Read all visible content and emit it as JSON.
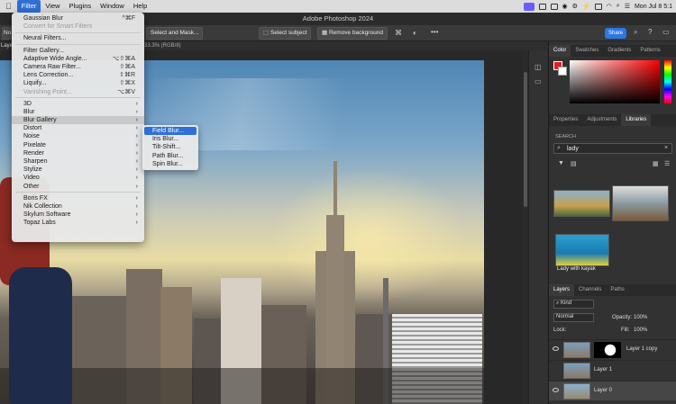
{
  "menubar": {
    "apple": "",
    "items": [
      "Filter",
      "View",
      "Plugins",
      "Window",
      "Help"
    ],
    "clock": "Mon Jul 8  5:1"
  },
  "app_title": "Adobe Photoshop 2024",
  "options": {
    "zoom": "33.3% (RGB/8)",
    "select_mask": "Select and Mask...",
    "select_subject": "Select subject",
    "remove_background": "Remove background",
    "share": "Share",
    "left_partial": "No",
    "layers_tab": "Layers"
  },
  "filter_menu": {
    "items": [
      {
        "label": "Gaussian Blur",
        "shortcut": "^⌘F"
      },
      {
        "label": "Convert for Smart Filters",
        "disabled": true
      },
      {
        "sep": true
      },
      {
        "label": "Neural Filters..."
      },
      {
        "sep": true
      },
      {
        "label": "Filter Gallery..."
      },
      {
        "label": "Adaptive Wide Angle...",
        "shortcut": "⌥⇧⌘A"
      },
      {
        "label": "Camera Raw Filter...",
        "shortcut": "⇧⌘A"
      },
      {
        "label": "Lens Correction...",
        "shortcut": "⇧⌘R"
      },
      {
        "label": "Liquify...",
        "shortcut": "⇧⌘X"
      },
      {
        "label": "Vanishing Point...",
        "shortcut": "⌥⌘V",
        "disabled": true
      },
      {
        "sep": true
      },
      {
        "label": "3D",
        "sub": true
      },
      {
        "label": "Blur",
        "sub": true
      },
      {
        "label": "Blur Gallery",
        "sub": true,
        "hover": true
      },
      {
        "label": "Distort",
        "sub": true
      },
      {
        "label": "Noise",
        "sub": true
      },
      {
        "label": "Pixelate",
        "sub": true
      },
      {
        "label": "Render",
        "sub": true
      },
      {
        "label": "Sharpen",
        "sub": true
      },
      {
        "label": "Stylize",
        "sub": true
      },
      {
        "label": "Video",
        "sub": true
      },
      {
        "label": "Other",
        "sub": true
      },
      {
        "sep": true
      },
      {
        "label": "Boris FX",
        "sub": true
      },
      {
        "label": "Nik Collection",
        "sub": true
      },
      {
        "label": "Skylum Software",
        "sub": true
      },
      {
        "label": "Topaz Labs",
        "sub": true
      }
    ]
  },
  "blur_gallery_submenu": {
    "items": [
      "Field Blur...",
      "Iris Blur...",
      "Tilt-Shift...",
      "Path Blur...",
      "Spin Blur..."
    ],
    "selected": 0
  },
  "color_panel": {
    "tabs": [
      "Color",
      "Swatches",
      "Gradients",
      "Patterns"
    ],
    "fg": "#e02020",
    "bg": "#ffffff"
  },
  "libraries_panel": {
    "tabs": [
      "Properties",
      "Adjustments",
      "Libraries"
    ],
    "search_label": "SEARCH",
    "search_value": "lady",
    "result_caption": "Lady with kayak"
  },
  "layers_panel": {
    "tabs": [
      "Layers",
      "Channels",
      "Paths"
    ],
    "kind": "Kind",
    "blend": "Normal",
    "opacity_label": "Opacity:",
    "opacity": "100%",
    "lock_label": "Lock:",
    "fill_label": "Fill:",
    "fill": "100%",
    "layers": [
      {
        "name": "Layer 1 copy",
        "visible": true
      },
      {
        "name": "Layer 1",
        "visible": false
      },
      {
        "name": "Layer 0",
        "visible": true
      }
    ]
  }
}
